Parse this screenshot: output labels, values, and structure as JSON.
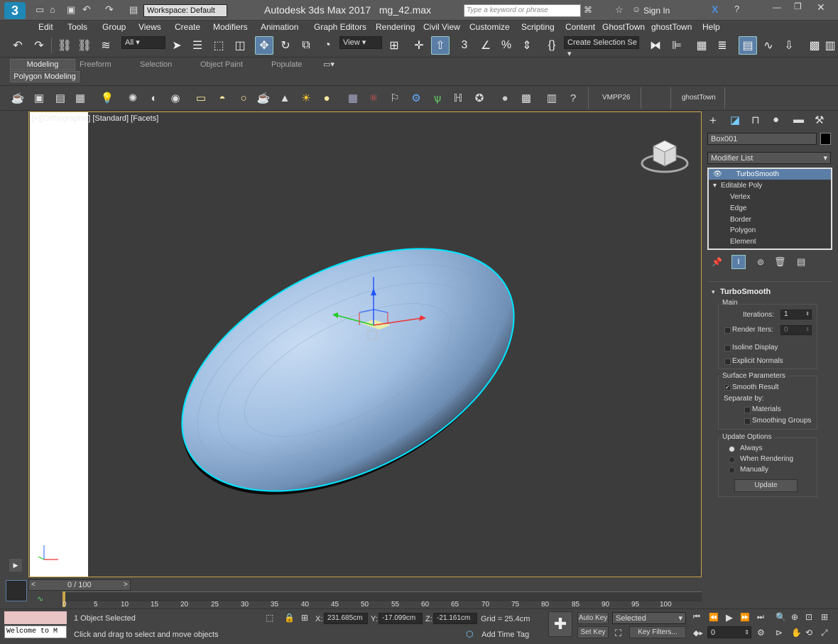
{
  "app": {
    "title": "Autodesk 3ds Max 2017",
    "file": "mg_42.max",
    "workspace": "Workspace: Default",
    "search_placeholder": "Type a keyword or phrase",
    "sign_in": "Sign In"
  },
  "menu": [
    "Edit",
    "Tools",
    "Group",
    "Views",
    "Create",
    "Modifiers",
    "Animation",
    "Graph Editors",
    "Rendering",
    "Civil View",
    "Customize",
    "Scripting",
    "Content",
    "GhostTown",
    "ghostTown",
    "Help"
  ],
  "toolbar": {
    "filter": "All",
    "view": "View",
    "selection_set": "Create Selection Se"
  },
  "ribbon": {
    "tabs": [
      "Modeling",
      "Freeform",
      "Selection",
      "Object Paint",
      "Populate"
    ],
    "active_tab": "Modeling",
    "subtab": "Polygon Modeling"
  },
  "ribbon2": {
    "vmpp": "VMPP26",
    "ghost": "ghostTown"
  },
  "viewport": {
    "label_plus": "[+]",
    "label_view": "[Orthographic]",
    "label_shading": "[Standard]",
    "label_facets": "[Facets]"
  },
  "command_panel": {
    "object_name": "Box001",
    "modifier_list": "Modifier List",
    "stack": [
      "TurboSmooth",
      "Editable Poly",
      "Vertex",
      "Edge",
      "Border",
      "Polygon",
      "Element"
    ],
    "rollout": {
      "title": "TurboSmooth",
      "main": "Main",
      "iterations_label": "Iterations:",
      "iterations": "1",
      "render_iters_label": "Render Iters:",
      "render_iters": "0",
      "isoline": "Isoline Display",
      "explicit": "Explicit Normals",
      "surface": "Surface Parameters",
      "smooth": "Smooth Result",
      "separate": "Separate by:",
      "materials": "Materials",
      "smoothing": "Smoothing Groups",
      "update_options": "Update Options",
      "always": "Always",
      "when_rendering": "When Rendering",
      "manually": "Manually",
      "update_btn": "Update"
    }
  },
  "timeline": {
    "frame": "0 / 100",
    "ticks": [
      "0",
      "5",
      "10",
      "15",
      "20",
      "25",
      "30",
      "35",
      "40",
      "45",
      "50",
      "55",
      "60",
      "65",
      "70",
      "75",
      "80",
      "85",
      "90",
      "95",
      "100"
    ]
  },
  "status": {
    "maxscript": "Welcome to M",
    "selected": "1 Object Selected",
    "hint": "Click and drag to select and move objects",
    "x_label": "X:",
    "x": "231.685cm",
    "y_label": "Y:",
    "y": "-17.099cm",
    "z_label": "Z:",
    "z": "-21.161cm",
    "grid": "Grid = 25.4cm",
    "add_time_tag": "Add Time Tag",
    "auto_key": "Auto Key",
    "set_key": "Set Key",
    "key_mode": "Selected",
    "key_filters": "Key Filters...",
    "frame_field": "0"
  },
  "colors": {
    "accent": "#5b7ea6",
    "selection": "#00e5ff",
    "object": "#9fbde0"
  }
}
